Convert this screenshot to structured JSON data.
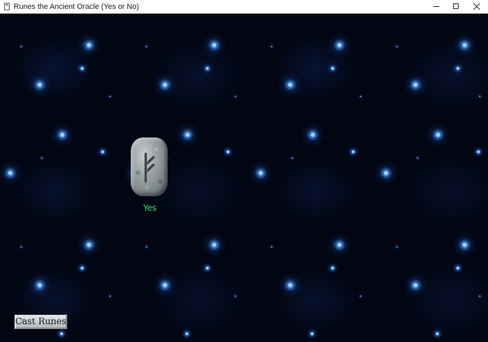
{
  "window": {
    "title": "Runes the Ancient Oracle (Yes or No)",
    "controls": {
      "minimize": "minimize-icon",
      "maximize": "maximize-icon",
      "close": "close-icon"
    }
  },
  "oracle": {
    "rune_name": "Fehu",
    "answer": "Yes",
    "answer_color": "#2ee66a"
  },
  "actions": {
    "cast_label": "Cast Runes"
  },
  "colors": {
    "background": "#020612",
    "star_glow": "#50a0ff",
    "stone": "#9ea5a7"
  }
}
